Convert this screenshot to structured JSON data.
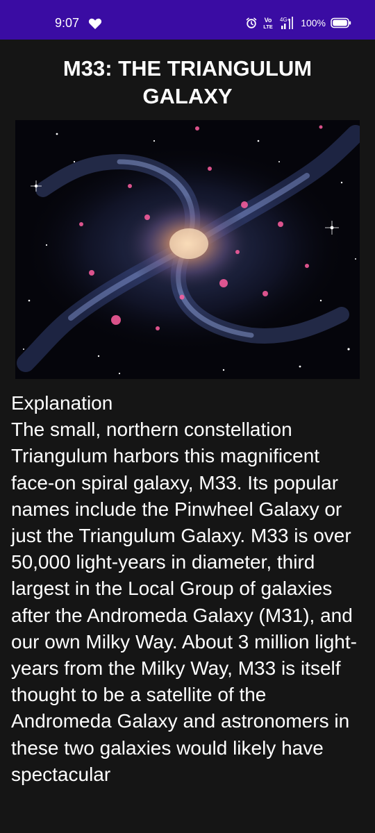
{
  "status_bar": {
    "time": "9:07",
    "volte_label_top": "Vo",
    "volte_label_bottom": "LTE",
    "network_label": "4G+",
    "battery_percent": "100%",
    "background_color": "#3a0ca3"
  },
  "article": {
    "title": "M33: THE TRIANGULUM GALAXY",
    "heading": "Explanation",
    "body": "The small, northern constellation Triangulum harbors this magnificent face-on spiral galaxy, M33. Its popular names include the Pinwheel Galaxy or just the Triangulum Galaxy. M33 is over 50,000 light-years in diameter, third largest in the Local Group of galaxies after the Andromeda Galaxy (M31), and our own Milky Way. About 3 million light-years from the Milky Way, M33 is itself thought to be a satellite of the Andromeda Galaxy and astronomers in these two galaxies would likely have spectacular"
  },
  "icons": {
    "heart": "heart-icon",
    "alarm": "alarm-icon",
    "volte": "volte-icon",
    "signal": "signal-icon",
    "battery": "battery-icon"
  }
}
